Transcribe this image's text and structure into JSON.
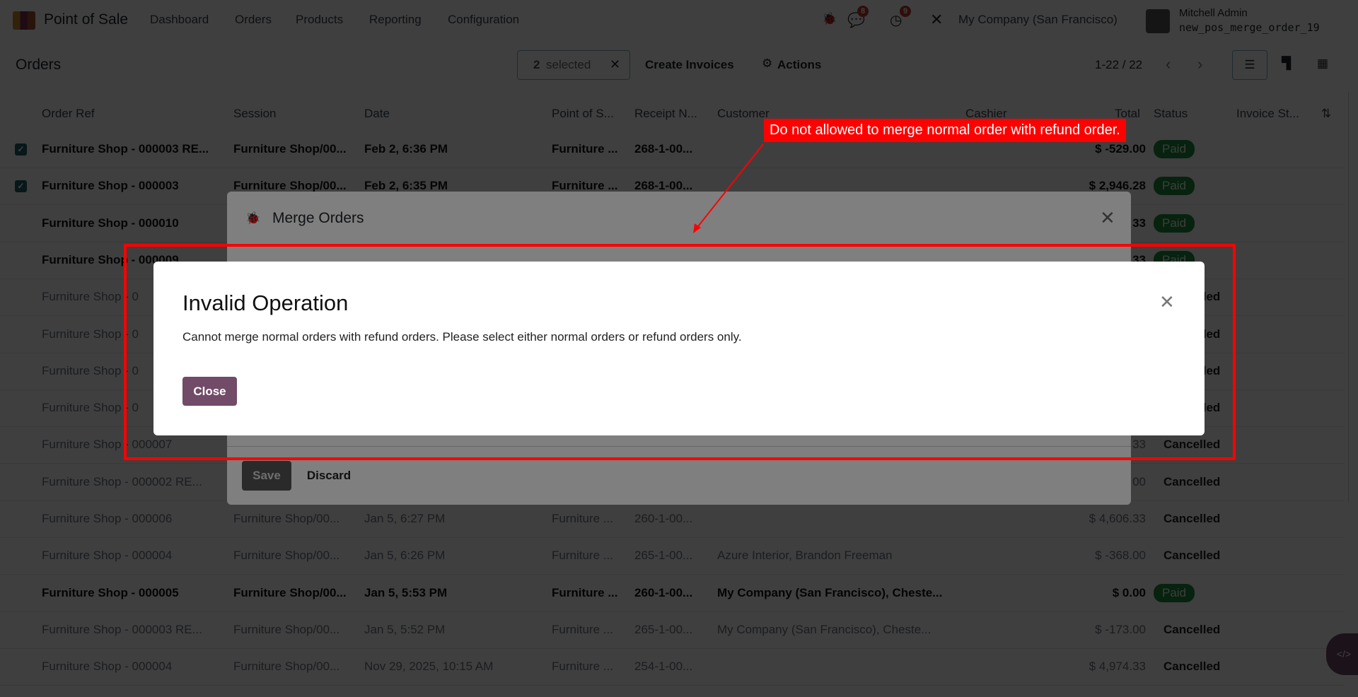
{
  "navbar": {
    "app_name": "Point of Sale",
    "menu": [
      "Dashboard",
      "Orders",
      "Products",
      "Reporting",
      "Configuration"
    ],
    "messages_count": "8",
    "activities_count": "9",
    "company": "My Company (San Francisco)",
    "user_name": "Mitchell Admin",
    "database": "new_pos_merge_order_19"
  },
  "control": {
    "title": "Orders",
    "selected_count": "2",
    "selected_label": "selected",
    "create_invoices": "Create Invoices",
    "actions": "Actions",
    "pager": "1-22 / 22"
  },
  "columns": [
    "Order Ref",
    "Session",
    "Date",
    "Point of S...",
    "Receipt N...",
    "Customer",
    "Cashier",
    "Total",
    "Status",
    "Invoice St..."
  ],
  "rows": [
    {
      "ref": "Furniture Shop - 000003 RE...",
      "session": "Furniture Shop/00...",
      "date": "Feb 2, 6:36 PM",
      "pos": "Furniture ...",
      "receipt": "268-1-00...",
      "customer": "",
      "total": "$ -529.00",
      "status": "Paid",
      "checked": true,
      "style": "bold"
    },
    {
      "ref": "Furniture Shop - 000003",
      "session": "Furniture Shop/00...",
      "date": "Feb 2, 6:35 PM",
      "pos": "Furniture ...",
      "receipt": "268-1-00...",
      "customer": "",
      "total": "$ 2,946.28",
      "status": "Paid",
      "checked": true,
      "style": "bold"
    },
    {
      "ref": "Furniture Shop - 000010",
      "total": "33",
      "status": "Paid",
      "style": "bold"
    },
    {
      "ref": "Furniture Shop - 000009",
      "total": "33",
      "status": "Paid",
      "style": "bold"
    },
    {
      "ref": "Furniture Shop - 0",
      "status": "Cancelled",
      "style": "muted"
    },
    {
      "ref": "Furniture Shop - 0",
      "status": "Cancelled",
      "style": "muted"
    },
    {
      "ref": "Furniture Shop - 0",
      "status": "Cancelled",
      "style": "muted"
    },
    {
      "ref": "Furniture Shop - 0",
      "status": "Cancelled",
      "style": "muted"
    },
    {
      "ref": "Furniture Shop - 000007",
      "total": "33",
      "status": "Cancelled",
      "style": "muted"
    },
    {
      "ref": "Furniture Shop - 000002 RE...",
      "total": "00",
      "status": "Cancelled",
      "style": "muted"
    },
    {
      "ref": "Furniture Shop - 000006",
      "session": "Furniture Shop/00...",
      "date": "Jan 5, 6:27 PM",
      "pos": "Furniture ...",
      "receipt": "260-1-00...",
      "customer": "",
      "total": "$ 4,606.33",
      "status": "Cancelled",
      "style": "muted"
    },
    {
      "ref": "Furniture Shop - 000004",
      "session": "Furniture Shop/00...",
      "date": "Jan 5, 6:26 PM",
      "pos": "Furniture ...",
      "receipt": "265-1-00...",
      "customer": "Azure Interior, Brandon Freeman",
      "total": "$ -368.00",
      "status": "Cancelled",
      "style": "muted"
    },
    {
      "ref": "Furniture Shop - 000005",
      "session": "Furniture Shop/00...",
      "date": "Jan 5, 5:53 PM",
      "pos": "Furniture ...",
      "receipt": "260-1-00...",
      "customer": "My Company (San Francisco), Cheste...",
      "total": "$ 0.00",
      "status": "Paid",
      "style": "bold"
    },
    {
      "ref": "Furniture Shop - 000003 RE...",
      "session": "Furniture Shop/00...",
      "date": "Jan 5, 5:52 PM",
      "pos": "Furniture ...",
      "receipt": "265-1-00...",
      "customer": "My Company (San Francisco), Cheste...",
      "total": "$ -173.00",
      "status": "Cancelled",
      "style": "muted"
    },
    {
      "ref": "Furniture Shop - 000004",
      "session": "Furniture Shop/00...",
      "date": "Nov 29, 2025, 10:15 AM",
      "pos": "Furniture ...",
      "receipt": "254-1-00...",
      "customer": "",
      "total": "$ 4,974.33",
      "status": "Cancelled",
      "style": "muted"
    }
  ],
  "merge_dialog": {
    "title": "Merge Orders",
    "save": "Save",
    "discard": "Discard"
  },
  "error_dialog": {
    "title": "Invalid Operation",
    "message": "Cannot merge normal orders with refund orders. Please select either normal orders or refund orders only.",
    "close": "Close"
  },
  "annotation": {
    "text": "Do not allowed to merge normal order with refund order.",
    "color": "#ff0000"
  },
  "colors": {
    "primary": "#714b67",
    "paid": "#1f8a3e"
  }
}
